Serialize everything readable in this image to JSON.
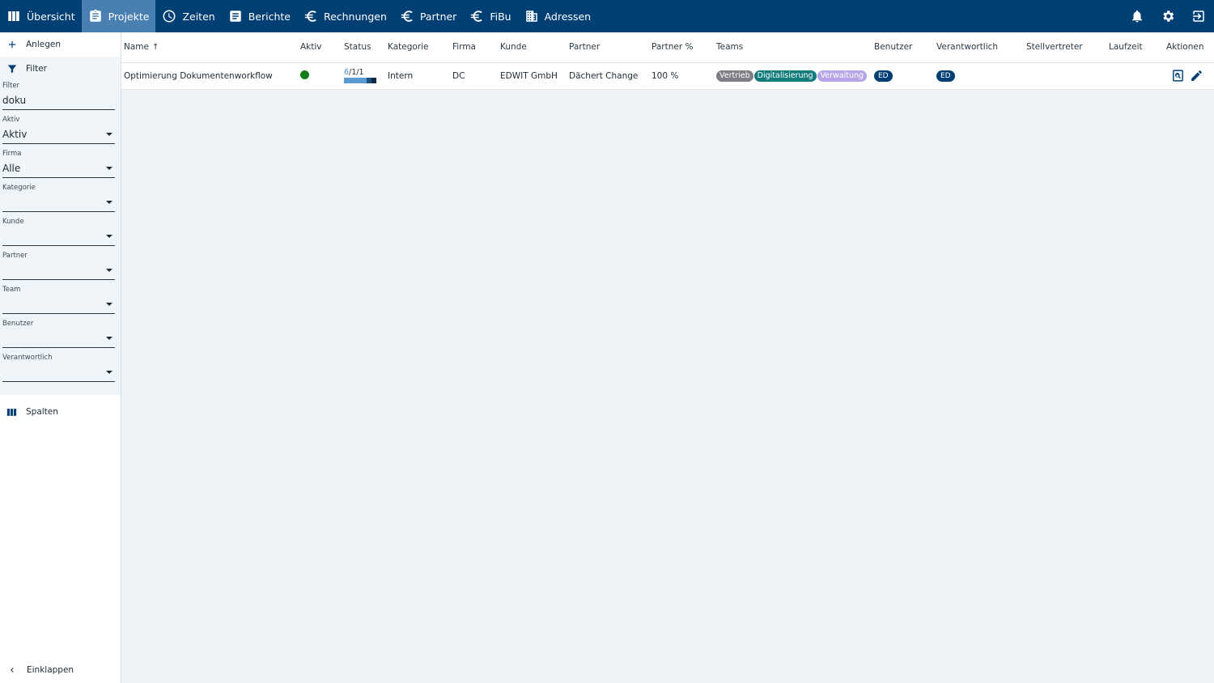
{
  "nav": {
    "items": [
      {
        "label": "Übersicht",
        "icon": "columns-icon"
      },
      {
        "label": "Projekte",
        "icon": "clipboard-icon"
      },
      {
        "label": "Zeiten",
        "icon": "clock-icon"
      },
      {
        "label": "Berichte",
        "icon": "document-icon"
      },
      {
        "label": "Rechnungen",
        "icon": "euro-icon"
      },
      {
        "label": "Partner",
        "icon": "euro-icon"
      },
      {
        "label": "FiBu",
        "icon": "euro-icon"
      },
      {
        "label": "Adressen",
        "icon": "building-icon"
      }
    ],
    "active": "Projekte",
    "right_icons": [
      "bell-icon",
      "gear-icon",
      "logout-icon"
    ]
  },
  "sidebar": {
    "create_label": "Anlegen",
    "filter_label": "Filter",
    "fields": {
      "filter": {
        "label": "Filter",
        "value": "doku"
      },
      "aktiv": {
        "label": "Aktiv",
        "value": "Aktiv"
      },
      "firma": {
        "label": "Firma",
        "value": "Alle"
      },
      "kategorie": {
        "label": "Kategorie",
        "value": ""
      },
      "kunde": {
        "label": "Kunde",
        "value": ""
      },
      "partner": {
        "label": "Partner",
        "value": ""
      },
      "team": {
        "label": "Team",
        "value": ""
      },
      "benutzer": {
        "label": "Benutzer",
        "value": ""
      },
      "verantwortlich": {
        "label": "Verantwortlich",
        "value": ""
      }
    },
    "columns_label": "Spalten",
    "collapse_label": "Einklappen"
  },
  "table": {
    "headers": {
      "name": "Name",
      "aktiv": "Aktiv",
      "status": "Status",
      "kategorie": "Kategorie",
      "firma": "Firma",
      "kunde": "Kunde",
      "partner": "Partner",
      "partner_pct": "Partner %",
      "teams": "Teams",
      "benutzer": "Benutzer",
      "verantwortlich": "Verantwortlich",
      "stellvertreter": "Stellvertreter",
      "laufzeit": "Laufzeit",
      "aktionen": "Aktionen"
    },
    "sort_indicator": "↑",
    "rows": [
      {
        "name": "Optimierung Dokumentenworkflow",
        "aktiv": true,
        "status_a": "6",
        "status_b": "/1/1",
        "kategorie": "Intern",
        "firma": "DC",
        "kunde": "EDWIT GmbH",
        "partner": "Dächert Change",
        "partner_pct": "100 %",
        "teams": [
          "Vertrieb",
          "Digitalisierung",
          "Verwaltung"
        ],
        "benutzer": "ED",
        "verantwortlich": "ED",
        "stellvertreter": "",
        "laufzeit": ""
      }
    ]
  },
  "colors": {
    "topbar": "#003f74",
    "active_tab": "#4a7fb1",
    "active_dot": "#127c16",
    "chip_vertrieb": "#7d7f84",
    "chip_digitalisierung": "#127c7c",
    "chip_verwaltung": "#b6a6e8"
  }
}
